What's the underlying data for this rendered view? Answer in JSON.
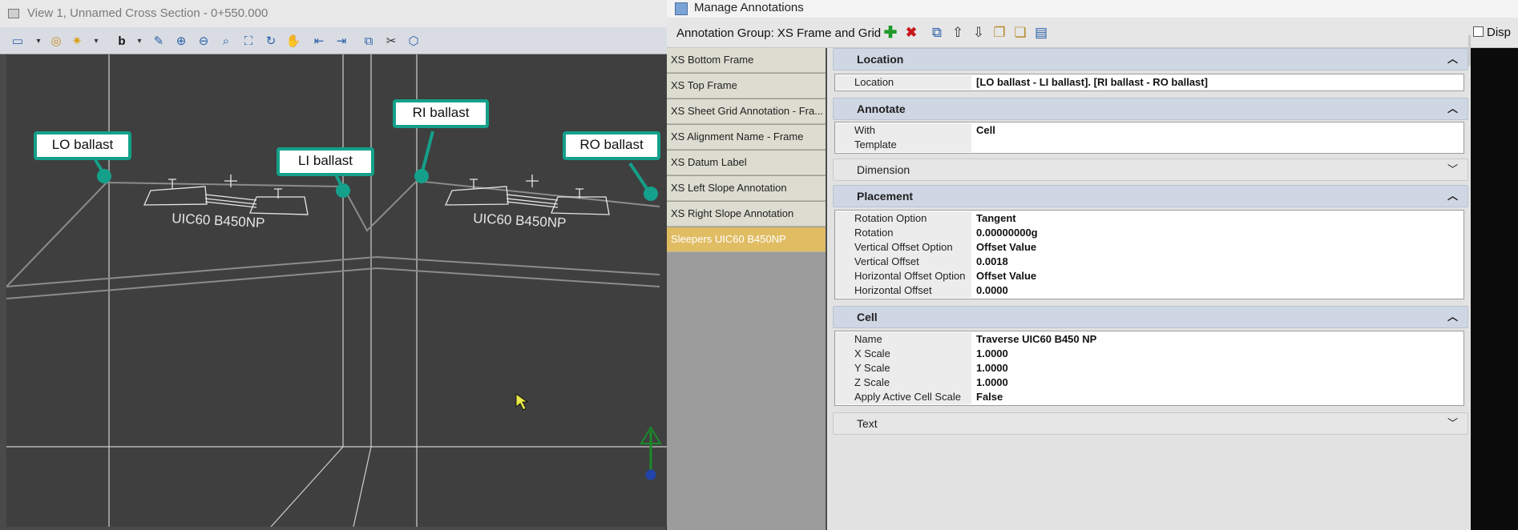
{
  "view": {
    "title": "View 1, Unnamed Cross Section - 0+550.000",
    "toolbar_icons": [
      "view-attributes-icon",
      "display-style-icon",
      "light-icon",
      "bing-icon",
      "brush-icon",
      "zoom-in-icon",
      "zoom-out-icon",
      "window-area-icon",
      "fit-view-icon",
      "rotate-view-icon",
      "pan-view-icon",
      "previous-view-icon",
      "next-view-icon",
      "copy-view-icon",
      "clip-volume-icon",
      "view-settings-icon"
    ],
    "callouts": [
      "LO ballast",
      "LI ballast",
      "RI ballast",
      "RO ballast"
    ],
    "sleeper_label_1": "UIC60 B450NP",
    "sleeper_label_2": "UIC60 B450NP"
  },
  "dialog": {
    "title": "Manage Annotations",
    "group_label": "Annotation Group: XS Frame and Grid",
    "display_label": "Disp",
    "list_items": [
      "XS Bottom Frame",
      "XS Top Frame",
      "XS Sheet Grid Annotation - Fra...",
      "XS Alignment Name - Frame",
      "XS Datum Label",
      "XS Left Slope Annotation",
      "XS Right Slope Annotation",
      "Sleepers UIC60 B450NP"
    ],
    "selected_index": 7,
    "sections": {
      "location": {
        "title": "Location",
        "rows": [
          {
            "k": "Location",
            "v": "[LO ballast - LI ballast]. [RI ballast - RO ballast]"
          }
        ]
      },
      "annotate": {
        "title": "Annotate",
        "rows": [
          {
            "k": "With",
            "v": "Cell"
          },
          {
            "k": "Template",
            "v": ""
          }
        ]
      },
      "dimension": {
        "title": "Dimension"
      },
      "placement": {
        "title": "Placement",
        "rows": [
          {
            "k": "Rotation Option",
            "v": "Tangent"
          },
          {
            "k": "Rotation",
            "v": "0.00000000g"
          },
          {
            "k": "Vertical Offset Option",
            "v": "Offset Value"
          },
          {
            "k": "Vertical Offset",
            "v": "0.0018"
          },
          {
            "k": "Horizontal Offset Option",
            "v": "Offset Value"
          },
          {
            "k": "Horizontal Offset",
            "v": "0.0000"
          }
        ]
      },
      "cell": {
        "title": "Cell",
        "rows": [
          {
            "k": "Name",
            "v": "Traverse UIC60 B450 NP"
          },
          {
            "k": "X Scale",
            "v": "1.0000"
          },
          {
            "k": "Y Scale",
            "v": "1.0000"
          },
          {
            "k": "Z Scale",
            "v": "1.0000"
          },
          {
            "k": "Apply Active Cell Scale",
            "v": "False"
          }
        ]
      },
      "text": {
        "title": "Text"
      }
    }
  },
  "colors": {
    "callout_border": "#14a08a",
    "selected_item": "#e0bc63",
    "section_header": "#cfd7e4"
  }
}
